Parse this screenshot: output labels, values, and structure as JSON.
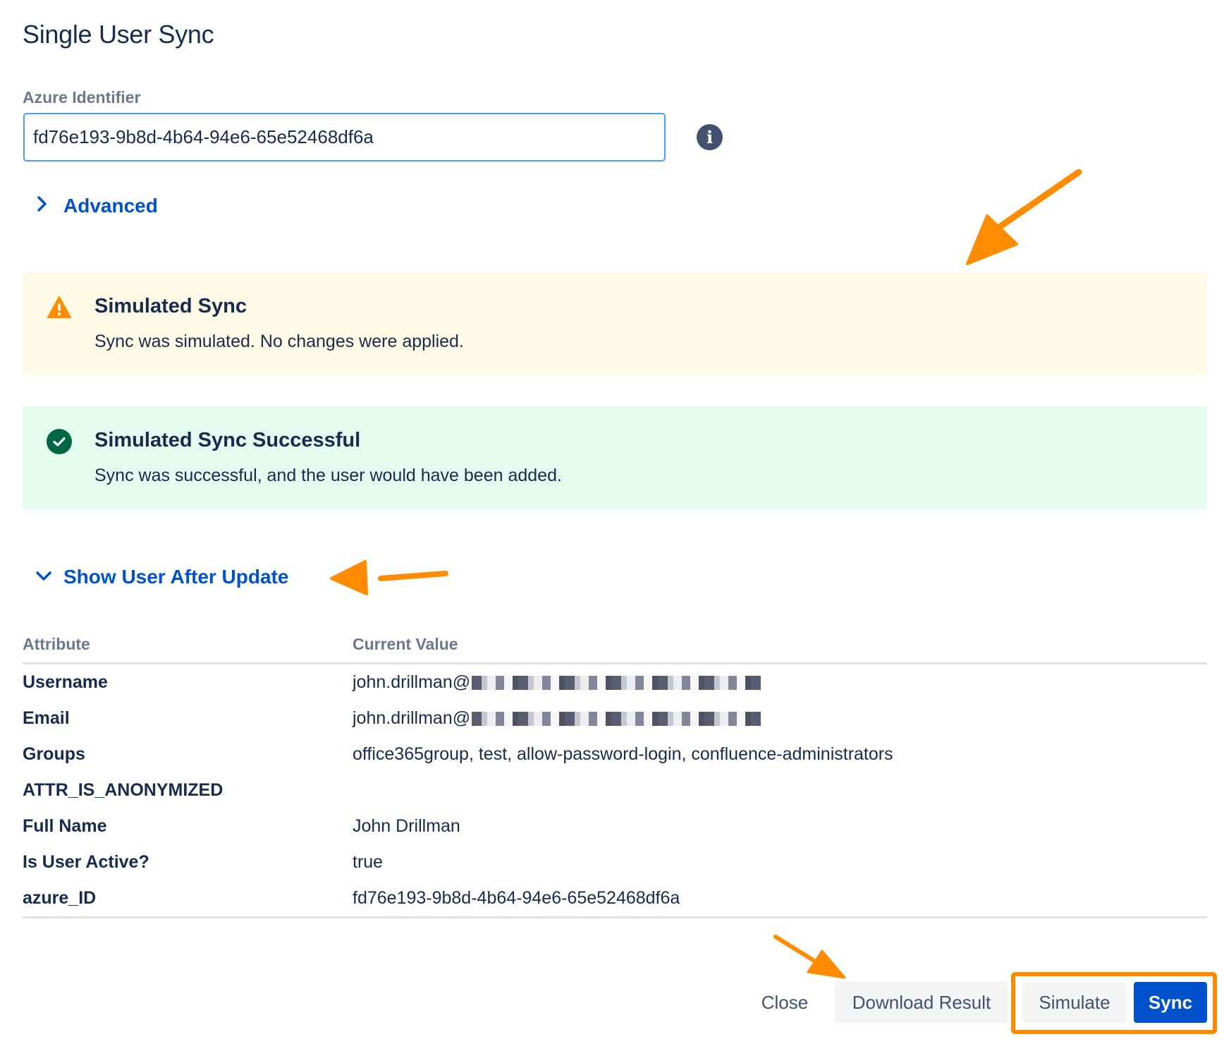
{
  "dialog": {
    "title": "Single User Sync"
  },
  "azure_field": {
    "label": "Azure Identifier",
    "value": "fd76e193-9b8d-4b64-94e6-65e52468df6a",
    "info_icon": "info-icon"
  },
  "advanced": {
    "label": "Advanced",
    "icon": "chevron-right-icon"
  },
  "messages": {
    "warning": {
      "icon": "warning-icon",
      "color": "#ff8b00",
      "title": "Simulated Sync",
      "body": "Sync was simulated. No changes were applied."
    },
    "success": {
      "icon": "check-circle-icon",
      "color": "#006644",
      "title": "Simulated Sync Successful",
      "body": "Sync was successful, and the user would have been added."
    }
  },
  "details_toggle": {
    "label": "Show User After Update",
    "icon": "chevron-down-icon"
  },
  "table": {
    "headers": {
      "attribute": "Attribute",
      "value": "Current Value"
    },
    "rows": [
      {
        "attribute": "Username",
        "value": "john.drillman@"
      },
      {
        "attribute": "Email",
        "value": "john.drillman@"
      },
      {
        "attribute": "Groups",
        "value": "office365group, test, allow-password-login, confluence-administrators"
      },
      {
        "attribute": "ATTR_IS_ANONYMIZED",
        "value": ""
      },
      {
        "attribute": "Full Name",
        "value": "John Drillman"
      },
      {
        "attribute": "Is User Active?",
        "value": "true"
      },
      {
        "attribute": "azure_ID",
        "value": "fd76e193-9b8d-4b64-94e6-65e52468df6a"
      }
    ]
  },
  "footer": {
    "close_label": "Close",
    "download_label": "Download Result",
    "simulate_label": "Simulate",
    "sync_label": "Sync"
  },
  "colors": {
    "accent": "#0052cc",
    "annotation": "#ff8b00",
    "input_focus": "#4c9aff"
  }
}
